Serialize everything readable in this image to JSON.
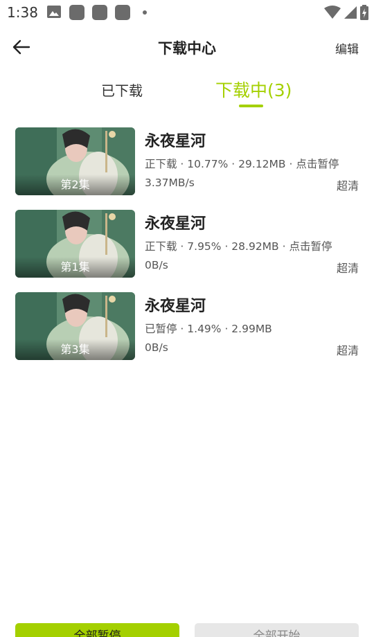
{
  "status_bar": {
    "time": "1:38",
    "icons": [
      "image-icon",
      "notification-icon",
      "notification-icon",
      "notification-icon",
      "dot-icon",
      "wifi-icon",
      "signal-icon",
      "battery-charging-icon"
    ]
  },
  "header": {
    "title": "下载中心",
    "edit_label": "编辑",
    "back_icon": "arrow-left-icon"
  },
  "tabs": [
    {
      "label": "已下载",
      "active": false
    },
    {
      "label": "下载中(3)",
      "active": true
    }
  ],
  "accent_color": "#a4d000",
  "downloads": [
    {
      "episode": "第2集",
      "title": "永夜星河",
      "status": "正下载 · 10.77% · 29.12MB · 点击暂停",
      "speed": "3.37MB/s",
      "quality": "超清",
      "progress_percent": 10.77
    },
    {
      "episode": "第1集",
      "title": "永夜星河",
      "status": "正下载 · 7.95% · 28.92MB · 点击暂停",
      "speed": "0B/s",
      "quality": "超清",
      "progress_percent": 7.95
    },
    {
      "episode": "第3集",
      "title": "永夜星河",
      "status": "已暂停 · 1.49% · 2.99MB",
      "speed": "0B/s",
      "quality": "超清",
      "progress_percent": 1.49
    }
  ],
  "bottom": {
    "pause_all_label": "全部暂停",
    "start_all_label": "全部开始"
  }
}
